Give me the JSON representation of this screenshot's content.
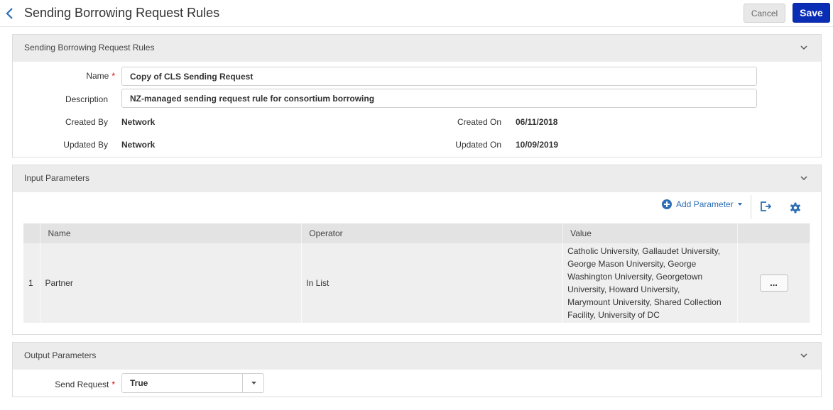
{
  "header": {
    "title": "Sending Borrowing Request Rules",
    "cancel_label": "Cancel",
    "save_label": "Save"
  },
  "rules_panel": {
    "title": "Sending Borrowing Request Rules",
    "name_label": "Name",
    "name_value": "Copy of CLS Sending Request",
    "description_label": "Description",
    "description_value": "NZ-managed sending request rule for consortium borrowing",
    "created_by_label": "Created By",
    "created_by_value": "Network",
    "updated_by_label": "Updated By",
    "updated_by_value": "Network",
    "created_on_label": "Created On",
    "created_on_value": "06/11/2018",
    "updated_on_label": "Updated On",
    "updated_on_value": "10/09/2019",
    "required_mark": "*"
  },
  "input_panel": {
    "title": "Input Parameters",
    "add_parameter_label": "Add Parameter",
    "columns": [
      "Name",
      "Operator",
      "Value"
    ],
    "rows": [
      {
        "index": "1",
        "name": "Partner",
        "operator": "In List",
        "value": "Catholic University, Gallaudet University, George Mason University, George Washington University, Georgetown University, Howard University, Marymount University, Shared Collection Facility, University of DC",
        "action_label": "..."
      }
    ]
  },
  "output_panel": {
    "title": "Output Parameters",
    "send_request_label": "Send Request",
    "send_request_value": "True",
    "required_mark": "*"
  },
  "colors": {
    "accent": "#0a2db5",
    "link": "#2d6fb5",
    "required": "#d40000",
    "panel_header": "#ececec"
  },
  "icons": {
    "back": "chevron-left-icon",
    "collapse": "chevron-down-icon",
    "add": "plus-circle-icon",
    "export": "export-icon",
    "settings": "gear-icon"
  }
}
